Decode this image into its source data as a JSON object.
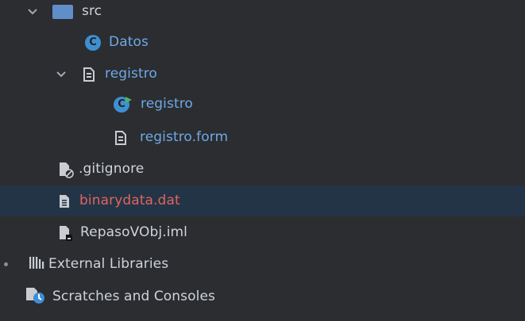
{
  "tree": {
    "src_label": "src",
    "datos_label": "Datos",
    "registro_package_label": "registro",
    "registro_class_label": "registro",
    "registro_form_label": "registro.form",
    "gitignore_label": ".gitignore",
    "binarydata_label": "binarydata.dat",
    "iml_label": "RepasoVObj.iml",
    "external_libraries_label": "External Libraries",
    "scratches_label": "Scratches and Consoles"
  },
  "icons": {
    "chevron": "chevron-down-icon",
    "folder": "folder-icon",
    "class": "java-class-icon",
    "form": "form-file-icon",
    "gitignore": "ignore-file-icon",
    "data_file": "text-file-icon",
    "iml": "module-file-icon",
    "libraries": "libraries-icon",
    "scratches": "scratches-icon"
  },
  "colors": {
    "background": "#2b2d30",
    "selected_row": "#243447",
    "text_default": "#cfd3da",
    "text_blue": "#6fa8e8",
    "text_error": "#e0645d",
    "class_icon": "#3f8fd0"
  }
}
